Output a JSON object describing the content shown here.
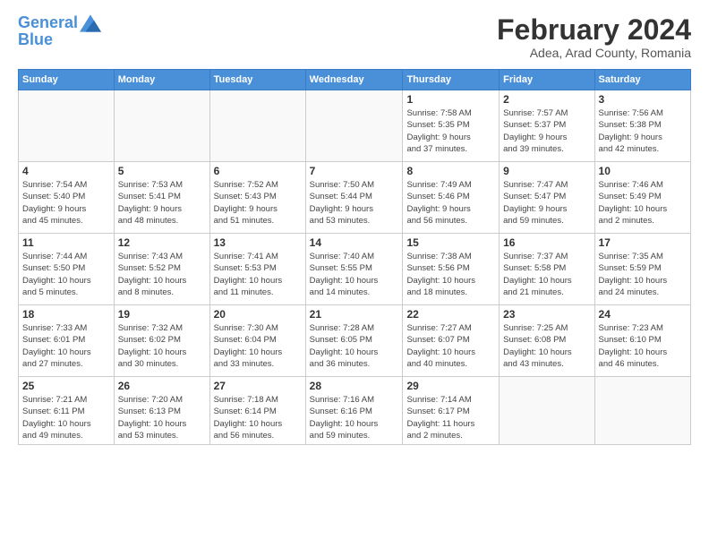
{
  "logo": {
    "line1": "General",
    "line2": "Blue"
  },
  "title": "February 2024",
  "location": "Adea, Arad County, Romania",
  "days_header": [
    "Sunday",
    "Monday",
    "Tuesday",
    "Wednesday",
    "Thursday",
    "Friday",
    "Saturday"
  ],
  "weeks": [
    [
      {
        "day": "",
        "info": ""
      },
      {
        "day": "",
        "info": ""
      },
      {
        "day": "",
        "info": ""
      },
      {
        "day": "",
        "info": ""
      },
      {
        "day": "1",
        "info": "Sunrise: 7:58 AM\nSunset: 5:35 PM\nDaylight: 9 hours\nand 37 minutes."
      },
      {
        "day": "2",
        "info": "Sunrise: 7:57 AM\nSunset: 5:37 PM\nDaylight: 9 hours\nand 39 minutes."
      },
      {
        "day": "3",
        "info": "Sunrise: 7:56 AM\nSunset: 5:38 PM\nDaylight: 9 hours\nand 42 minutes."
      }
    ],
    [
      {
        "day": "4",
        "info": "Sunrise: 7:54 AM\nSunset: 5:40 PM\nDaylight: 9 hours\nand 45 minutes."
      },
      {
        "day": "5",
        "info": "Sunrise: 7:53 AM\nSunset: 5:41 PM\nDaylight: 9 hours\nand 48 minutes."
      },
      {
        "day": "6",
        "info": "Sunrise: 7:52 AM\nSunset: 5:43 PM\nDaylight: 9 hours\nand 51 minutes."
      },
      {
        "day": "7",
        "info": "Sunrise: 7:50 AM\nSunset: 5:44 PM\nDaylight: 9 hours\nand 53 minutes."
      },
      {
        "day": "8",
        "info": "Sunrise: 7:49 AM\nSunset: 5:46 PM\nDaylight: 9 hours\nand 56 minutes."
      },
      {
        "day": "9",
        "info": "Sunrise: 7:47 AM\nSunset: 5:47 PM\nDaylight: 9 hours\nand 59 minutes."
      },
      {
        "day": "10",
        "info": "Sunrise: 7:46 AM\nSunset: 5:49 PM\nDaylight: 10 hours\nand 2 minutes."
      }
    ],
    [
      {
        "day": "11",
        "info": "Sunrise: 7:44 AM\nSunset: 5:50 PM\nDaylight: 10 hours\nand 5 minutes."
      },
      {
        "day": "12",
        "info": "Sunrise: 7:43 AM\nSunset: 5:52 PM\nDaylight: 10 hours\nand 8 minutes."
      },
      {
        "day": "13",
        "info": "Sunrise: 7:41 AM\nSunset: 5:53 PM\nDaylight: 10 hours\nand 11 minutes."
      },
      {
        "day": "14",
        "info": "Sunrise: 7:40 AM\nSunset: 5:55 PM\nDaylight: 10 hours\nand 14 minutes."
      },
      {
        "day": "15",
        "info": "Sunrise: 7:38 AM\nSunset: 5:56 PM\nDaylight: 10 hours\nand 18 minutes."
      },
      {
        "day": "16",
        "info": "Sunrise: 7:37 AM\nSunset: 5:58 PM\nDaylight: 10 hours\nand 21 minutes."
      },
      {
        "day": "17",
        "info": "Sunrise: 7:35 AM\nSunset: 5:59 PM\nDaylight: 10 hours\nand 24 minutes."
      }
    ],
    [
      {
        "day": "18",
        "info": "Sunrise: 7:33 AM\nSunset: 6:01 PM\nDaylight: 10 hours\nand 27 minutes."
      },
      {
        "day": "19",
        "info": "Sunrise: 7:32 AM\nSunset: 6:02 PM\nDaylight: 10 hours\nand 30 minutes."
      },
      {
        "day": "20",
        "info": "Sunrise: 7:30 AM\nSunset: 6:04 PM\nDaylight: 10 hours\nand 33 minutes."
      },
      {
        "day": "21",
        "info": "Sunrise: 7:28 AM\nSunset: 6:05 PM\nDaylight: 10 hours\nand 36 minutes."
      },
      {
        "day": "22",
        "info": "Sunrise: 7:27 AM\nSunset: 6:07 PM\nDaylight: 10 hours\nand 40 minutes."
      },
      {
        "day": "23",
        "info": "Sunrise: 7:25 AM\nSunset: 6:08 PM\nDaylight: 10 hours\nand 43 minutes."
      },
      {
        "day": "24",
        "info": "Sunrise: 7:23 AM\nSunset: 6:10 PM\nDaylight: 10 hours\nand 46 minutes."
      }
    ],
    [
      {
        "day": "25",
        "info": "Sunrise: 7:21 AM\nSunset: 6:11 PM\nDaylight: 10 hours\nand 49 minutes."
      },
      {
        "day": "26",
        "info": "Sunrise: 7:20 AM\nSunset: 6:13 PM\nDaylight: 10 hours\nand 53 minutes."
      },
      {
        "day": "27",
        "info": "Sunrise: 7:18 AM\nSunset: 6:14 PM\nDaylight: 10 hours\nand 56 minutes."
      },
      {
        "day": "28",
        "info": "Sunrise: 7:16 AM\nSunset: 6:16 PM\nDaylight: 10 hours\nand 59 minutes."
      },
      {
        "day": "29",
        "info": "Sunrise: 7:14 AM\nSunset: 6:17 PM\nDaylight: 11 hours\nand 2 minutes."
      },
      {
        "day": "",
        "info": ""
      },
      {
        "day": "",
        "info": ""
      }
    ]
  ]
}
